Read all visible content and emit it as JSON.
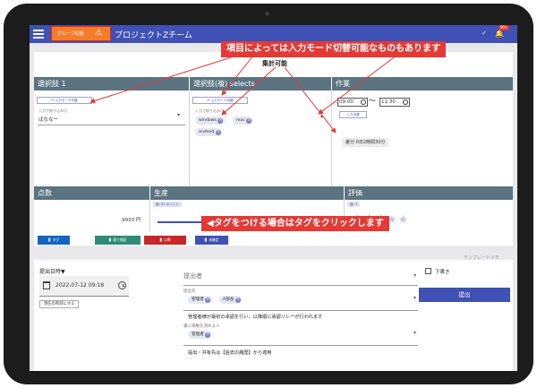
{
  "app": {
    "title": "プロジェクトZチーム",
    "group_button_label": "グループ切替",
    "notification_count": "99+"
  },
  "annotations": {
    "top_callout": "項目によっては入力モード切替可能なものもあります",
    "aggregate_label": "集計可能",
    "tag_callout": "◀タグをつける場合はタグをクリックします"
  },
  "sections": {
    "choice1": {
      "title": "選択肢 1",
      "mode_button": "入力モード切替",
      "filter_label": "入力で絞り込み可",
      "value": "ばななー"
    },
    "choice_multi": {
      "title": "選択肢(複) selects",
      "mode_button": "入力モード切替",
      "filter_label": "入力で絞り込み可",
      "chips": [
        "windows",
        "mac",
        "android"
      ]
    },
    "work": {
      "title": "作業",
      "start_time": "09:00",
      "separator": "〜",
      "end_time": "11:30",
      "mode_button": "入力切替",
      "diff_text": "差分:0日2時間30分"
    },
    "score": {
      "title": "点数",
      "value": "9933 円"
    },
    "production": {
      "title": "生産",
      "tag": "値: 92 ポイント",
      "slider_value": 0.92
    },
    "rating": {
      "title": "評価",
      "tag": "値: 3",
      "stars_filled": 3,
      "stars_total": 5
    }
  },
  "action_buttons": [
    {
      "label": "タグ",
      "color": "#1565c0"
    },
    {
      "label": "値で検証",
      "color": "#2e8b74"
    },
    {
      "label": "以降",
      "color": "#c62828"
    },
    {
      "label": "未確定",
      "color": "#3f51b5"
    }
  ],
  "template_link": "テンプレートメモ",
  "submission": {
    "date_label": "提出日時▼",
    "date_value": "2022-07-12 09:18",
    "now_button": "現在の時刻にする",
    "submitter_placeholder": "提出者",
    "recipients_label": "提出先",
    "recipients_chips": [
      "管理者",
      "A部長"
    ],
    "recipients_note": "管理者様が最初の承認を行い、以降順に承認リレーが行われます",
    "cc_label": "書に目敷を頂める人",
    "cc_chips": [
      "管理者"
    ],
    "history_note": "提出・共有先は【過去の履歴】から適用",
    "draft_label": "下書き",
    "submit_button": "提出"
  },
  "colors": {
    "primary": "#3f51b5",
    "header_bar": "#5c7481",
    "callout": "#e53935",
    "group_button": "#f57c2b"
  }
}
